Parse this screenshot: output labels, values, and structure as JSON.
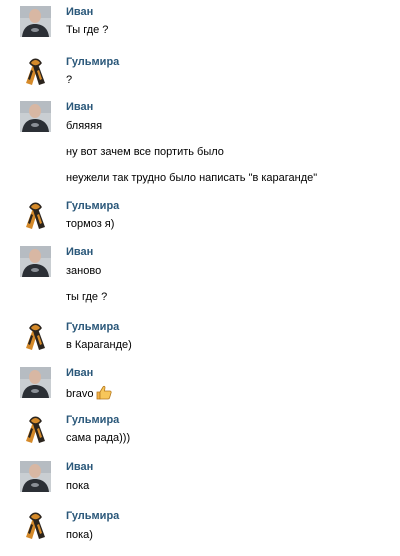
{
  "messages": [
    {
      "author": "Иван",
      "avatar": "ivan-avatar",
      "lines": [
        "Ты где ?"
      ]
    },
    {
      "author": "Гульмира",
      "avatar": "gulmira-avatar",
      "lines": [
        "?"
      ]
    },
    {
      "author": "Иван",
      "avatar": "ivan-avatar",
      "lines": [
        "бляяяя",
        "ну вот зачем все портить было",
        "неужели так трудно было написать \"в караганде\""
      ]
    },
    {
      "author": "Гульмира",
      "avatar": "gulmira-avatar",
      "lines": [
        "тормоз я)"
      ]
    },
    {
      "author": "Иван",
      "avatar": "ivan-avatar",
      "lines": [
        "заново",
        "ты где ?"
      ]
    },
    {
      "author": "Гульмира",
      "avatar": "gulmira-avatar",
      "lines": [
        "в Караганде)"
      ]
    },
    {
      "author": "Иван",
      "avatar": "ivan-avatar",
      "lines": [
        "bravo"
      ],
      "emoji": "thumbs-up-icon"
    },
    {
      "author": "Гульмира",
      "avatar": "gulmira-avatar",
      "lines": [
        "сама рада)))"
      ]
    },
    {
      "author": "Иван",
      "avatar": "ivan-avatar",
      "lines": [
        "пока"
      ]
    },
    {
      "author": "Гульмира",
      "avatar": "gulmira-avatar",
      "lines": [
        "пока)"
      ]
    }
  ],
  "colors": {
    "author_name": "#2b587a",
    "message_text": "#000000",
    "background": "#ffffff"
  }
}
